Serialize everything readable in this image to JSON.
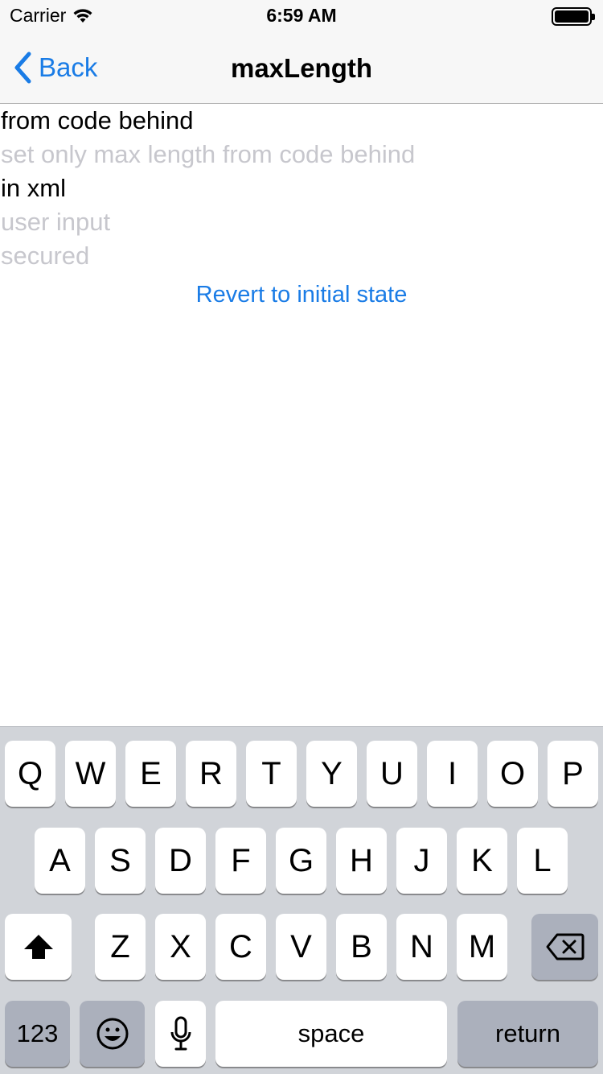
{
  "status_bar": {
    "carrier": "Carrier",
    "time": "6:59 AM"
  },
  "nav": {
    "back_label": "Back",
    "title": "maxLength"
  },
  "fields": [
    {
      "value": "from code behind",
      "placeholder": ""
    },
    {
      "value": "",
      "placeholder": "set only max length from code behind"
    },
    {
      "value": "in xml",
      "placeholder": ""
    },
    {
      "value": "",
      "placeholder": "user input"
    },
    {
      "value": "",
      "placeholder": "secured"
    }
  ],
  "revert_label": "Revert to initial state",
  "keyboard": {
    "row1": [
      "Q",
      "W",
      "E",
      "R",
      "T",
      "Y",
      "U",
      "I",
      "O",
      "P"
    ],
    "row2": [
      "A",
      "S",
      "D",
      "F",
      "G",
      "H",
      "J",
      "K",
      "L"
    ],
    "row3": [
      "Z",
      "X",
      "C",
      "V",
      "B",
      "N",
      "M"
    ],
    "numbers_label": "123",
    "space_label": "space",
    "return_label": "return"
  },
  "colors": {
    "accent": "#1a7ce6",
    "placeholder": "#c7c7cd",
    "keyboard_bg": "#d1d4d9"
  }
}
